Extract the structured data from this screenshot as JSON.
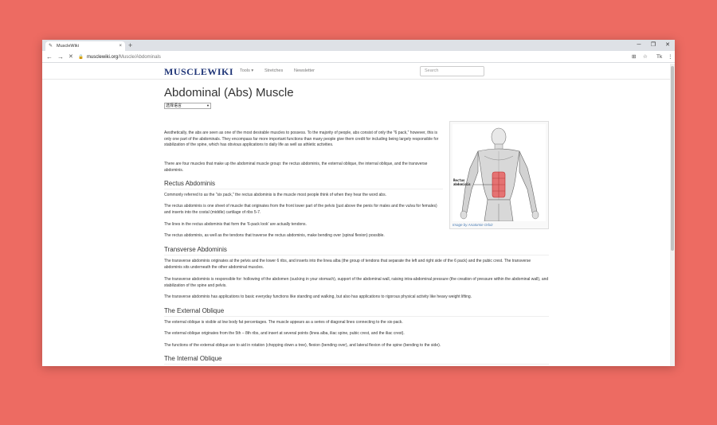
{
  "browser": {
    "tab_title": "MuscleWiki",
    "tab_close": "×",
    "new_tab": "+",
    "url_host": "musclewiki.org",
    "url_path": "/Muscle/Abdominals",
    "win_minimize": "─",
    "win_maximize": "❐",
    "win_close": "✕",
    "back": "←",
    "forward": "→",
    "stop": "✕",
    "ext1": "⊞",
    "ext2": "☆",
    "ext3": "Tk",
    "menu": "⋮"
  },
  "site": {
    "logo": "MUSCLEWIKI",
    "nav": [
      "Tools ▾",
      "Stretches",
      "Newsletter"
    ],
    "search_placeholder": "Search"
  },
  "page": {
    "title": "Abdominal (Abs) Muscle",
    "language_select": "选择语言",
    "figure_caption": "Image by Anatomie Orbiz",
    "figure_label": "Rectus abdominis",
    "intro": [
      "Aesthetically, the abs are seen as one of the most desirable muscles to possess. To the majority of people, abs consist of only the \"6 pack,\" however, this is only one part of the abdominals. They encompass far more important functions than many people give them credit for including being largely responsible for stabilization of the spine, which has obvious applications to daily life as well as athletic activities.",
      "There are four muscles that make up the abdominal muscle group: the rectus abdominis, the external oblique, the internal oblique, and the transverse abdominis."
    ],
    "sections": [
      {
        "heading": "Rectus Abdominis",
        "paragraphs": [
          "Commonly referred to as the \"six pack,\" the rectus abdominis is the muscle most people think of when they hear the word abs.",
          "The rectus abdominis is one sheet of muscle that originates from the front lower part of the pelvis (just above the penis for males and the vulva for females) and inserts into the costal (middle) cartilage of ribs 5-7.",
          "The lines in the rectus abdominis that form the '6-pack look' are actually tendons.",
          "The rectus abdominis, as well as the tendons that traverse the rectus abdominis, make bending over (spinal flexion) possible."
        ]
      },
      {
        "heading": "Transverse Abdominis",
        "paragraphs": [
          "The transverse abdominis originates at the pelvis and the lower 6 ribs, and inserts into the linea alba (the group of tendons that separate the left and right side of the 6 pack) and the pubic crest. The transverse abdominis sits underneath the other abdominal muscles.",
          "The transverse abdominis is responsible for: hollowing of the abdomen (sucking in your stomach), support of the abdominal wall, raising intra-abdominal pressure (the creation of pressure within the abdominal wall), and stabilization of the spine and pelvis.",
          "The transverse abdominis has applications to basic everyday functions like standing and walking, but also has applications to rigorous physical activity like heavy weight lifting."
        ]
      },
      {
        "heading": "The External Oblique",
        "paragraphs": [
          "The external oblique is visible at low body fat percentages. The muscle appears as a series of diagonal lines connecting to the six-pack.",
          "The external oblique originates from the 5th – 8th ribs, and insert at several points (linea alba, iliac spine, pubic crest, and the iliac crest).",
          "The functions of the external oblique are to aid in rotation (chopping down a tree), flexion (bending over), and lateral flexion of the spine (bending to the side)."
        ]
      },
      {
        "heading": "The Internal Oblique",
        "paragraphs": []
      }
    ]
  }
}
